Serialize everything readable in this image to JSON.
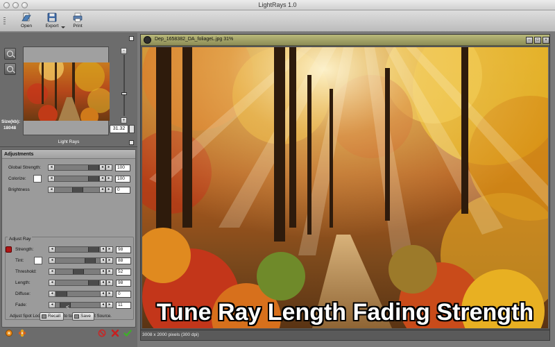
{
  "window": {
    "title": "LightRays 1.0"
  },
  "toolbar": {
    "open_label": "Open",
    "export_label": "Export",
    "print_label": "Print",
    "icons": {
      "open": "open-file-icon",
      "export": "save-disk-icon",
      "print": "printer-icon"
    }
  },
  "navigator": {
    "size_label": "Size(kb):",
    "size_value": "18048",
    "zoom_value": "31.32",
    "zoom_minus": "-",
    "zoom_plus": "+",
    "zoom_level": 0.62
  },
  "light_rays_panel": {
    "title": "Light Rays"
  },
  "adjustments": {
    "title": "Adjustments",
    "global_strength": {
      "label": "Global Strength:",
      "value": "100",
      "level": 1.0
    },
    "colorize": {
      "label": "Colorize:",
      "value": "100",
      "level": 1.0,
      "swatch": "#ffffff"
    },
    "brightness": {
      "label": "Brightness",
      "value": "0",
      "level": 0.5
    },
    "adjust_ray": {
      "title": "Adjust Ray",
      "strength": {
        "label": "Strength:",
        "value": "98",
        "level": 0.98,
        "swatch": "#b01616"
      },
      "tint": {
        "label": "Tint:",
        "value": "88",
        "level": 0.88,
        "swatch": "#ffffff"
      },
      "threshold": {
        "label": "Threshold:",
        "value": "52",
        "level": 0.52
      },
      "length": {
        "label": "Length:",
        "value": "98",
        "level": 0.98
      },
      "diffuse": {
        "label": "Diffuse:",
        "value": "0",
        "level": 0.0
      },
      "fade": {
        "label": "Fade:",
        "value": "11",
        "level": 0.11
      },
      "hint": "Adjust Spot Location on Photo to define Light Source."
    }
  },
  "buttons": {
    "recall": "Recall",
    "save": "Save",
    "collapse": "<"
  },
  "image_window": {
    "title": "Dep_1658382_DA_foliageL.jpg 31%",
    "caption": "Tune Ray Length Fading Strength",
    "status": "3008 x 2000 pixels (300 dpi)",
    "minimize": "–",
    "maximize": "□",
    "close": "×"
  },
  "colors": {
    "panel": "#6c6c6c",
    "accent_title": "#a8a86a"
  }
}
